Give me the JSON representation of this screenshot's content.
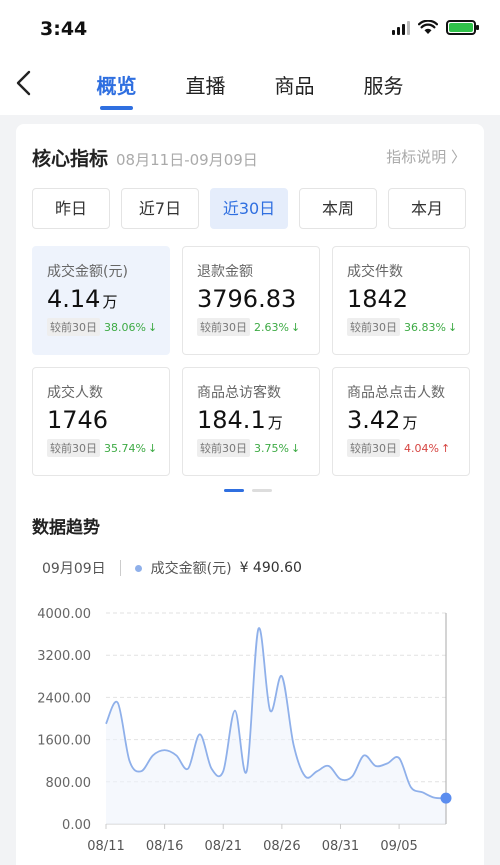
{
  "status_bar": {
    "time": "3:44"
  },
  "nav": {
    "tabs": [
      "概览",
      "直播",
      "商品",
      "服务"
    ],
    "active": 0
  },
  "core": {
    "title": "核心指标",
    "range": "08月11日-09月09日",
    "help": "指标说明 〉",
    "range_tabs": [
      "昨日",
      "近7日",
      "近30日",
      "本周",
      "本月"
    ],
    "active_range": 2
  },
  "metrics": [
    {
      "label": "成交金额(元)",
      "value": "4.14",
      "unit": "万",
      "compare": "较前30日",
      "pct": "38.06%",
      "arrow": "↓",
      "dir": "down"
    },
    {
      "label": "退款金额",
      "value": "3796.83",
      "unit": "",
      "compare": "较前30日",
      "pct": "2.63%",
      "arrow": "↓",
      "dir": "down"
    },
    {
      "label": "成交件数",
      "value": "1842",
      "unit": "",
      "compare": "较前30日",
      "pct": "36.83%",
      "arrow": "↓",
      "dir": "down"
    },
    {
      "label": "成交人数",
      "value": "1746",
      "unit": "",
      "compare": "较前30日",
      "pct": "35.74%",
      "arrow": "↓",
      "dir": "down"
    },
    {
      "label": "商品总访客数",
      "value": "184.1",
      "unit": "万",
      "compare": "较前30日",
      "pct": "3.75%",
      "arrow": "↓",
      "dir": "down"
    },
    {
      "label": "商品总点击人数",
      "value": "3.42",
      "unit": "万",
      "compare": "较前30日",
      "pct": "4.04%",
      "arrow": "↑",
      "dir": "up"
    }
  ],
  "colors": {
    "accent": "#2f6fe0",
    "down": "#3daa44",
    "up": "#d64541",
    "line": "#8fb0ea"
  },
  "trend": {
    "title": "数据趋势",
    "date": "09月09日",
    "series_label": "成交金额(元)",
    "value": "¥ 490.60"
  },
  "chart_data": {
    "type": "line",
    "title": "",
    "xlabel": "",
    "ylabel": "",
    "ylim": [
      0,
      4000
    ],
    "yticks": [
      "4000.00",
      "3200.00",
      "2400.00",
      "1600.00",
      "800.00",
      "0.00"
    ],
    "xticks": [
      "08/11",
      "08/16",
      "08/21",
      "08/26",
      "08/31",
      "09/05"
    ],
    "grid": true,
    "series": [
      {
        "name": "成交金额(元)",
        "x": [
          "08/11",
          "08/12",
          "08/13",
          "08/14",
          "08/15",
          "08/16",
          "08/17",
          "08/18",
          "08/19",
          "08/20",
          "08/21",
          "08/22",
          "08/23",
          "08/24",
          "08/25",
          "08/26",
          "08/27",
          "08/28",
          "08/29",
          "08/30",
          "08/31",
          "09/01",
          "09/02",
          "09/03",
          "09/04",
          "09/05",
          "09/06",
          "09/07",
          "09/08",
          "09/09"
        ],
        "values": [
          1900,
          2300,
          1200,
          1000,
          1300,
          1400,
          1300,
          1050,
          1700,
          1050,
          1000,
          2150,
          1000,
          3700,
          2150,
          2800,
          1500,
          900,
          1000,
          1100,
          850,
          900,
          1300,
          1100,
          1150,
          1250,
          700,
          600,
          500,
          490
        ]
      }
    ]
  }
}
